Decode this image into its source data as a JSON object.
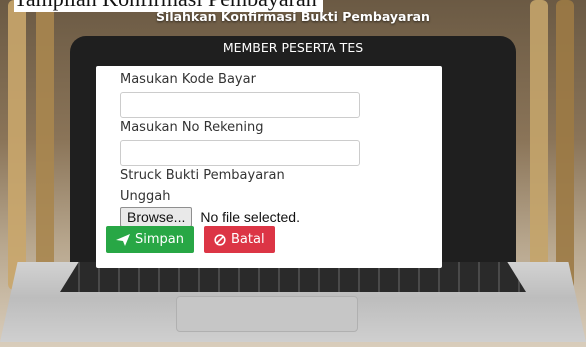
{
  "caption": "Tampilan Konfirmasi Pembayaran",
  "screen_title": "Silahkan Konfirmasi Bukti Pembayaran",
  "header": "MEMBER PESERTA TES",
  "form": {
    "kode_label": "Masukan Kode Bayar",
    "kode_value": "",
    "rekening_label": "Masukan No Rekening",
    "rekening_value": "",
    "struck_label": "Struck Bukti Pembayaran",
    "unggah_label": "Unggah",
    "browse_label": "Browse...",
    "file_status": "No file selected."
  },
  "buttons": {
    "save": "Simpan",
    "cancel": "Batal"
  },
  "colors": {
    "save": "#28a745",
    "cancel": "#dc3545"
  },
  "icons": {
    "save": "paper-plane-icon",
    "cancel": "ban-icon"
  }
}
